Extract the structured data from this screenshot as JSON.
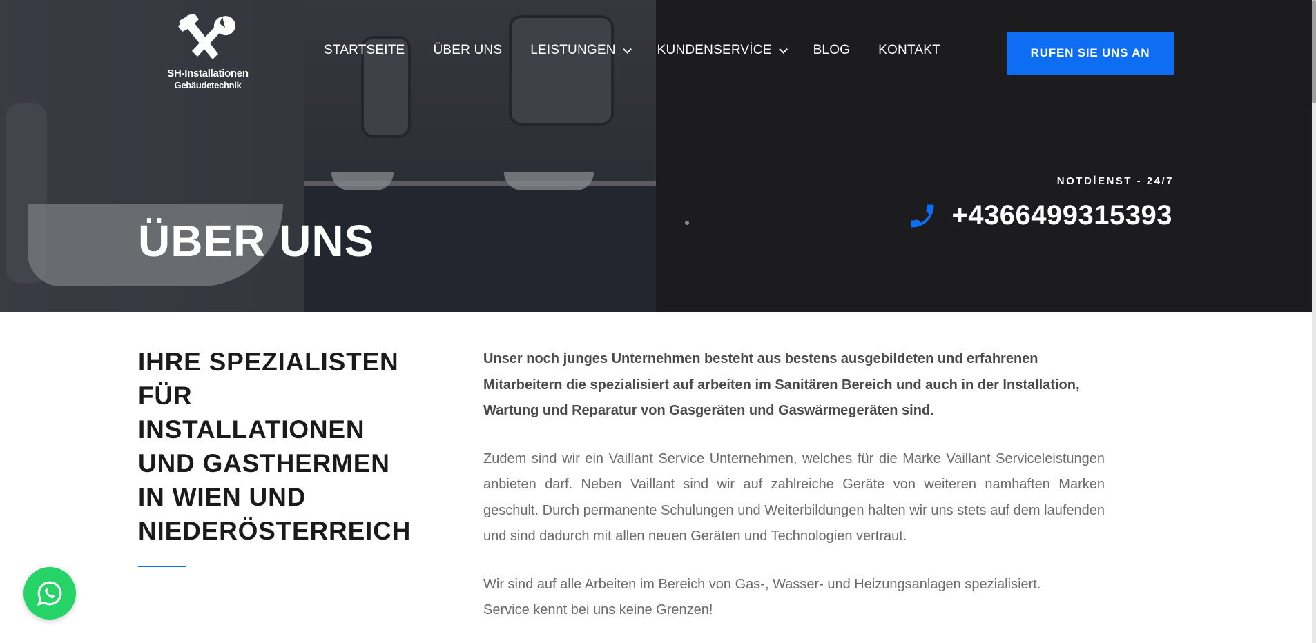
{
  "brand": {
    "name_line1": "SH-Installationen",
    "name_line2": "Gebäudetechnik",
    "logo_icon": "wrench-pipe-wrench-icon"
  },
  "nav": {
    "items": [
      {
        "label": "STARTSEITE",
        "has_dropdown": false
      },
      {
        "label": "ÜBER UNS",
        "has_dropdown": false
      },
      {
        "label": "LEISTUNGEN",
        "has_dropdown": true
      },
      {
        "label": "KUNDENSERVİCE",
        "has_dropdown": true
      },
      {
        "label": "BLOG",
        "has_dropdown": false
      },
      {
        "label": "KONTAKT",
        "has_dropdown": false
      }
    ],
    "cta_label": "RUFEN SIE UNS AN"
  },
  "hero": {
    "title": "ÜBER UNS",
    "emergency_label": "NOTDİENST - 24/7",
    "phone_number": "+4366499315393",
    "phone_icon": "phone-icon"
  },
  "about": {
    "heading_lines": [
      "IHRE SPEZIALISTEN",
      "FÜR",
      "INSTALLATIONEN",
      "UND GASTHERMEN",
      "IN WIEN UND",
      "NIEDERÖSTERREICH"
    ],
    "lead": "Unser noch junges Unternehmen besteht aus bestens ausgebildeten und erfahrenen Mitarbeitern die spezialisiert auf arbeiten im Sanitären Bereich und auch in der Installation, Wartung und Reparatur von Gasgeräten und Gaswärmegeräten sind.",
    "paragraph1": "Zudem sind wir ein Vaillant Service Unternehmen, welches für die Marke Vaillant Serviceleistungen anbieten darf. Neben Vaillant sind wir auf zahlreiche Geräte von weiteren namhaften Marken geschult. Durch permanente Schulungen und Weiterbildungen halten wir uns stets auf dem laufenden und sind dadurch mit allen neuen Geräten und Technologien vertraut.",
    "paragraph2": "Wir sind auf alle Arbeiten im Bereich von Gas-, Wasser- und Heizungsanlagen spezialisiert. Service kennt bei uns keine Grenzen!"
  },
  "floating": {
    "whatsapp_icon": "whatsapp-icon"
  },
  "colors": {
    "accent": "#0d6ef4",
    "hero_dark": "#1c1c1e",
    "whatsapp": "#25d366"
  }
}
